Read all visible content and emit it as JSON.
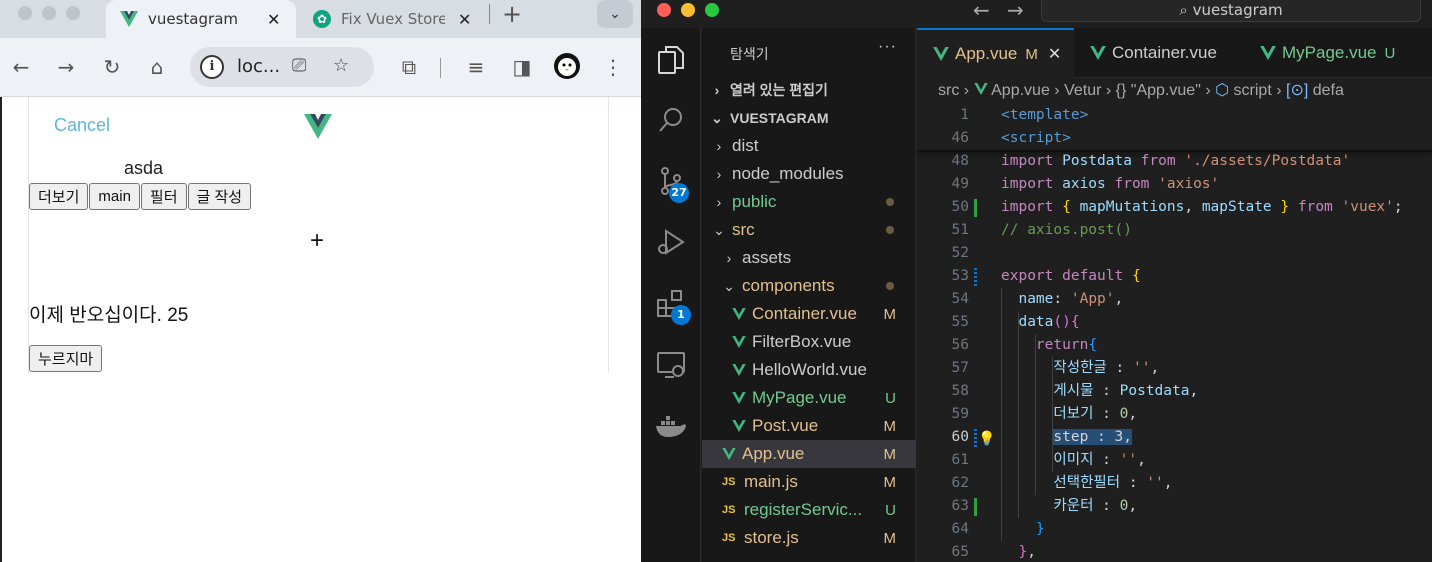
{
  "browser": {
    "tabs": [
      {
        "title": "vuestagram",
        "close": "✕"
      },
      {
        "title": "Fix Vuex Store",
        "close": "✕"
      }
    ],
    "new_tab": "+",
    "tab_dropdown": "⌄",
    "omnibox_text": "loc...",
    "page": {
      "cancel": "Cancel",
      "step_name": "asda",
      "buttons": [
        "더보기",
        "main",
        "필터",
        "글 작성"
      ],
      "plus": "+",
      "message": "이제 반오십이다. 25",
      "press_button": "누르지마"
    }
  },
  "vscode": {
    "search_text": "vuestagram",
    "explorer": {
      "title": "탐색기",
      "more": "···",
      "open_editors": "열려 있는 편집기",
      "project": "VUESTAGRAM",
      "items": [
        {
          "label": "dist",
          "kind": "folder",
          "expanded": false,
          "indent": 1,
          "color": "#cccccc",
          "status": ""
        },
        {
          "label": "node_modules",
          "kind": "folder",
          "expanded": false,
          "indent": 1,
          "color": "#cccccc",
          "status": ""
        },
        {
          "label": "public",
          "kind": "folder",
          "expanded": false,
          "indent": 1,
          "color": "#73c991",
          "status": "dot"
        },
        {
          "label": "src",
          "kind": "folder",
          "expanded": true,
          "indent": 1,
          "color": "#e2c08d",
          "status": "dot"
        },
        {
          "label": "assets",
          "kind": "folder",
          "expanded": false,
          "indent": 2,
          "color": "#cccccc",
          "status": ""
        },
        {
          "label": "components",
          "kind": "folder",
          "expanded": true,
          "indent": 2,
          "color": "#e2c08d",
          "status": "dot"
        },
        {
          "label": "Container.vue",
          "kind": "vue",
          "indent": 3,
          "color": "#e2c08d",
          "status": "M"
        },
        {
          "label": "FilterBox.vue",
          "kind": "vue",
          "indent": 3,
          "color": "#cccccc",
          "status": ""
        },
        {
          "label": "HelloWorld.vue",
          "kind": "vue",
          "indent": 3,
          "color": "#cccccc",
          "status": ""
        },
        {
          "label": "MyPage.vue",
          "kind": "vue",
          "indent": 3,
          "color": "#73c991",
          "status": "U"
        },
        {
          "label": "Post.vue",
          "kind": "vue",
          "indent": 3,
          "color": "#e2c08d",
          "status": "M"
        },
        {
          "label": "App.vue",
          "kind": "vue",
          "indent": 2,
          "color": "#e2c08d",
          "status": "M",
          "selected": true
        },
        {
          "label": "main.js",
          "kind": "js",
          "indent": 2,
          "color": "#e2c08d",
          "status": "M"
        },
        {
          "label": "registerServic...",
          "kind": "js",
          "indent": 2,
          "color": "#73c991",
          "status": "U"
        },
        {
          "label": "store.js",
          "kind": "js",
          "indent": 2,
          "color": "#e2c08d",
          "status": "M"
        }
      ]
    },
    "badges": {
      "source_control": "27",
      "extensions": "1"
    },
    "editor_tabs": [
      {
        "label": "App.vue",
        "mark": "M",
        "close": "✕",
        "color": "#e2c08d"
      },
      {
        "label": "Container.vue",
        "mark": "",
        "color": "#cccccc"
      },
      {
        "label": "MyPage.vue",
        "mark": "U",
        "color": "#73c991"
      }
    ],
    "breadcrumbs": [
      "src",
      "App.vue",
      "Vetur",
      "{} \"App.vue\"",
      "script",
      "defa"
    ],
    "code": [
      {
        "n": "1",
        "tokens": [
          [
            "tag",
            "<template>"
          ]
        ]
      },
      {
        "n": "46",
        "tokens": [
          [
            "tag",
            "<script>"
          ]
        ]
      },
      {
        "n": "48",
        "tokens": [
          [
            "kw",
            "import "
          ],
          [
            "id",
            "Postdata"
          ],
          [
            "kw",
            " from "
          ],
          [
            "str",
            "'./assets/Postdata'"
          ]
        ]
      },
      {
        "n": "49",
        "tokens": [
          [
            "kw",
            "import "
          ],
          [
            "id",
            "axios"
          ],
          [
            "kw",
            " from "
          ],
          [
            "str",
            "'axios'"
          ]
        ]
      },
      {
        "n": "50",
        "mark": "added",
        "tokens": [
          [
            "kw",
            "import "
          ],
          [
            "brace",
            "{ "
          ],
          [
            "id",
            "mapMutations"
          ],
          [
            "",
            ", "
          ],
          [
            "id",
            "mapState"
          ],
          [
            "brace",
            " }"
          ],
          [
            "kw",
            " from "
          ],
          [
            "str",
            "'vuex'"
          ],
          [
            "",
            ";"
          ]
        ]
      },
      {
        "n": "51",
        "tokens": [
          [
            "cm",
            "// axios.post()"
          ]
        ]
      },
      {
        "n": "52",
        "tokens": []
      },
      {
        "n": "53",
        "mark": "modified",
        "tokens": [
          [
            "kw",
            "export "
          ],
          [
            "kw",
            "default "
          ],
          [
            "brace",
            "{"
          ]
        ]
      },
      {
        "n": "54",
        "tokens": [
          [
            "",
            "  "
          ],
          [
            "id",
            "name"
          ],
          [
            "",
            ": "
          ],
          [
            "str",
            "'App'"
          ],
          [
            "",
            ","
          ]
        ]
      },
      {
        "n": "55",
        "tokens": [
          [
            "",
            "  "
          ],
          [
            "id",
            "data"
          ],
          [
            "brace2",
            "()"
          ],
          [
            "brace2",
            "{"
          ]
        ]
      },
      {
        "n": "56",
        "tokens": [
          [
            "",
            "    "
          ],
          [
            "kw",
            "return"
          ],
          [
            "brace3",
            "{"
          ]
        ]
      },
      {
        "n": "57",
        "tokens": [
          [
            "",
            "      "
          ],
          [
            "id",
            "작성한글"
          ],
          [
            "",
            " : "
          ],
          [
            "str",
            "''"
          ],
          [
            "",
            ","
          ]
        ]
      },
      {
        "n": "58",
        "tokens": [
          [
            "",
            "      "
          ],
          [
            "id",
            "게시물"
          ],
          [
            "",
            " : "
          ],
          [
            "id",
            "Postdata"
          ],
          [
            "",
            ","
          ]
        ]
      },
      {
        "n": "59",
        "tokens": [
          [
            "",
            "      "
          ],
          [
            "id",
            "더보기"
          ],
          [
            "",
            " : "
          ],
          [
            "num",
            "0"
          ],
          [
            "",
            ","
          ]
        ]
      },
      {
        "n": "60",
        "mark": "modified",
        "current": true,
        "tokens": [
          [
            "",
            "      "
          ],
          [
            "sel",
            "step : 3,"
          ]
        ]
      },
      {
        "n": "61",
        "tokens": [
          [
            "",
            "      "
          ],
          [
            "id",
            "이미지"
          ],
          [
            "",
            " : "
          ],
          [
            "str",
            "''"
          ],
          [
            "",
            ","
          ]
        ]
      },
      {
        "n": "62",
        "tokens": [
          [
            "",
            "      "
          ],
          [
            "id",
            "선택한필터"
          ],
          [
            "",
            " : "
          ],
          [
            "str",
            "''"
          ],
          [
            "",
            ","
          ]
        ]
      },
      {
        "n": "63",
        "mark": "added",
        "tokens": [
          [
            "",
            "      "
          ],
          [
            "id",
            "카운터"
          ],
          [
            "",
            " : "
          ],
          [
            "num",
            "0"
          ],
          [
            "",
            ","
          ]
        ]
      },
      {
        "n": "64",
        "tokens": [
          [
            "",
            "    "
          ],
          [
            "brace3",
            "}"
          ]
        ]
      },
      {
        "n": "65",
        "tokens": [
          [
            "",
            "  "
          ],
          [
            "brace2",
            "}"
          ],
          [
            "",
            ","
          ]
        ]
      }
    ]
  },
  "colors": {
    "vue_green": "#41b883",
    "vue_dark": "#35495e",
    "git_modified": "#e2c08d",
    "git_untracked": "#73c991",
    "accent": "#0078d4"
  }
}
